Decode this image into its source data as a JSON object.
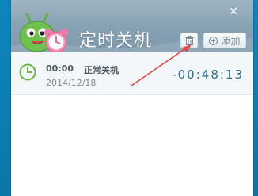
{
  "window": {
    "title": "定时关机",
    "close_symbol": "✕"
  },
  "toolbar": {
    "delete_icon": "trash-icon",
    "add_label": "添加"
  },
  "task": {
    "time": "00:00",
    "label": "正常关机",
    "date": "2014/12/18",
    "countdown": "-00:48:13"
  },
  "colors": {
    "header": "#8ba5b7",
    "accent_green": "#6ab84a",
    "countdown": "#2d6f8f",
    "annotation_arrow": "#e64545"
  }
}
